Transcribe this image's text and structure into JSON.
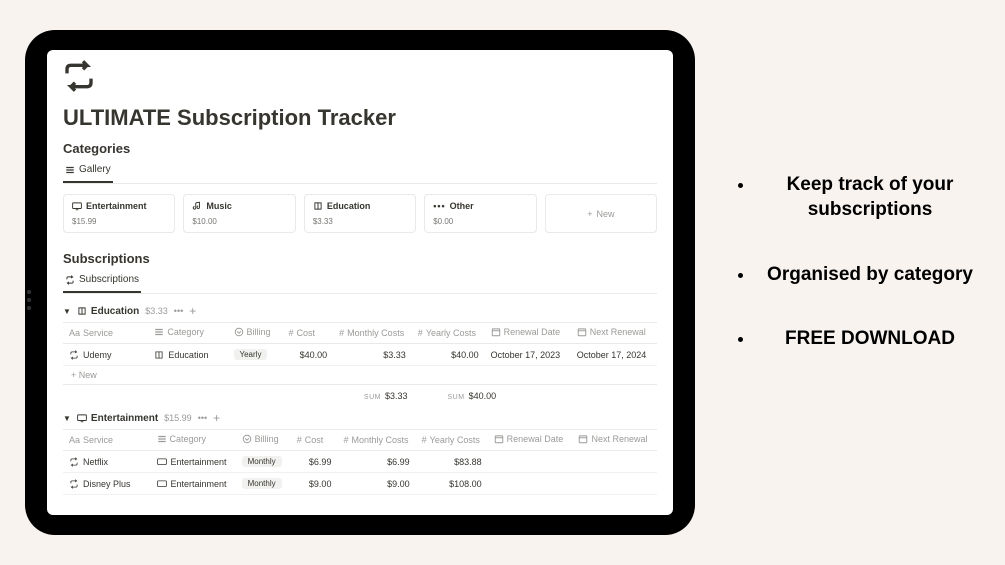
{
  "page": {
    "title": "ULTIMATE Subscription Tracker",
    "categories_heading": "Categories",
    "gallery_tab": "Gallery",
    "subscriptions_heading": "Subscriptions",
    "subscriptions_tab": "Subscriptions",
    "new_label": "New"
  },
  "category_cards": [
    {
      "icon": "tv",
      "name": "Entertainment",
      "price": "$15.99"
    },
    {
      "icon": "music",
      "name": "Music",
      "price": "$10.00"
    },
    {
      "icon": "book",
      "name": "Education",
      "price": "$3.33"
    },
    {
      "icon": "dots",
      "name": "Other",
      "price": "$0.00"
    }
  ],
  "columns": {
    "service": "Service",
    "category": "Category",
    "billing": "Billing",
    "cost": "Cost",
    "monthly": "Monthly Costs",
    "yearly": "Yearly Costs",
    "renewal": "Renewal Date",
    "next": "Next Renewal"
  },
  "groups": [
    {
      "name": "Education",
      "icon": "book",
      "price": "$3.33",
      "rows": [
        {
          "service": "Udemy",
          "category": "Education",
          "cat_icon": "book",
          "billing": "Yearly",
          "cost": "$40.00",
          "monthly": "$3.33",
          "yearly": "$40.00",
          "renewal": "October 17, 2023",
          "next": "October 17, 2024"
        }
      ],
      "sum_monthly": "$3.33",
      "sum_yearly": "$40.00",
      "show_sum": true,
      "show_new": true
    },
    {
      "name": "Entertainment",
      "icon": "tv",
      "price": "$15.99",
      "rows": [
        {
          "service": "Netflix",
          "category": "Entertainment",
          "cat_icon": "tv",
          "billing": "Monthly",
          "cost": "$6.99",
          "monthly": "$6.99",
          "yearly": "$83.88",
          "renewal": "",
          "next": ""
        },
        {
          "service": "Disney Plus",
          "category": "Entertainment",
          "cat_icon": "tv",
          "billing": "Monthly",
          "cost": "$9.00",
          "monthly": "$9.00",
          "yearly": "$108.00",
          "renewal": "",
          "next": ""
        }
      ],
      "show_sum": false,
      "show_new": false
    }
  ],
  "bullets": [
    "Keep track of your subscriptions",
    "Organised by category",
    "FREE DOWNLOAD"
  ],
  "labels": {
    "aa": "Aa",
    "sum": "SUM",
    "new_row": "New",
    "plus": "+"
  }
}
